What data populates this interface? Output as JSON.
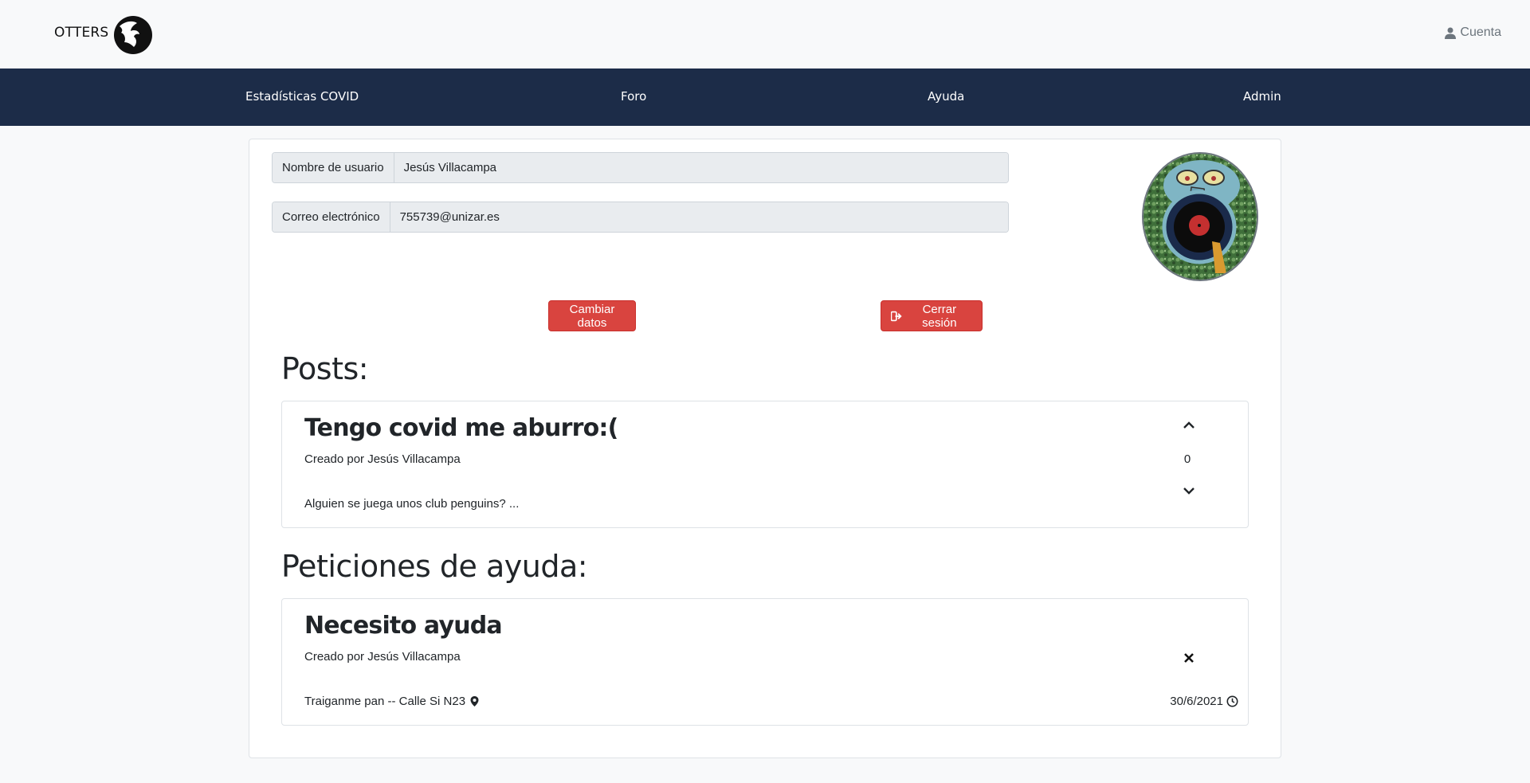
{
  "header": {
    "brand": "OTTERS",
    "account_label": "Cuenta"
  },
  "nav": {
    "items": [
      {
        "label": "Estadísticas COVID"
      },
      {
        "label": "Foro"
      },
      {
        "label": "Ayuda"
      },
      {
        "label": "Admin"
      }
    ]
  },
  "profile": {
    "username_label": "Nombre de usuario",
    "username_value": "Jesús Villacampa",
    "email_label": "Correo electrónico",
    "email_value": "755739@unizar.es",
    "change_button": "Cambiar datos",
    "logout_button": "Cerrar sesión"
  },
  "posts": {
    "title": "Posts:",
    "items": [
      {
        "title": "Tengo covid me aburro:(",
        "author": "Creado por Jesús Villacampa",
        "votes": "0",
        "excerpt": "Alguien se juega unos club penguins? ..."
      }
    ]
  },
  "help_requests": {
    "title": "Peticiones de ayuda:",
    "items": [
      {
        "title": "Necesito ayuda",
        "author": "Creado por Jesús Villacampa",
        "description": "Traiganme pan -- Calle Si N23",
        "date": "30/6/2021"
      }
    ]
  },
  "colors": {
    "navbar": "#1c2c48",
    "button": "#d9443f"
  }
}
